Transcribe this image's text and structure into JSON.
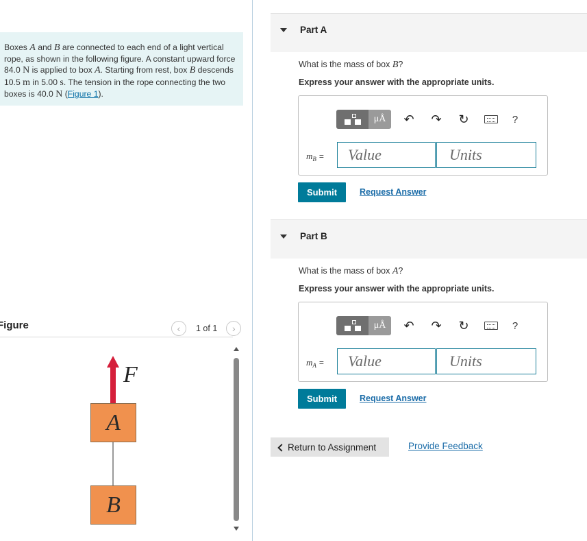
{
  "problem": {
    "t1": "Boxes ",
    "boxA": "A",
    "t2": " and ",
    "boxB": "B",
    "t3": " are connected to each end of a light vertical rope, as shown in the following figure. A constant upward force 84.0 ",
    "unitN1": "N",
    "t4": " is applied to box ",
    "boxA2": "A",
    "t5": ". Starting from rest, box ",
    "boxB2": "B",
    "t6": " descends 10.5 ",
    "unitM": "m",
    "t7": " in 5.00 ",
    "unitS": "s",
    "t8": ". The tension in the rope connecting the two boxes is 40.0 ",
    "unitN2": "N",
    "t9": " (",
    "figure_link": "Figure 1",
    "t10": ")."
  },
  "figure": {
    "title": "Figure",
    "pager": "1 of 1",
    "prev_icon": "chevron-left-icon",
    "next_icon": "chevron-right-icon",
    "force_label": "F",
    "box_a_label": "A",
    "box_b_label": "B",
    "colors": {
      "box": "#f0914e",
      "arrow": "#d51f3b"
    }
  },
  "partA": {
    "title": "Part A",
    "question_pre": "What is the mass of box ",
    "question_var": "B",
    "question_post": "?",
    "express": "Express your answer with the appropriate units.",
    "var_main": "m",
    "var_sub": "B",
    "eq": "=",
    "value_placeholder": "Value",
    "units_placeholder": "Units",
    "submit": "Submit",
    "request": "Request Answer"
  },
  "partB": {
    "title": "Part B",
    "question_pre": "What is the mass of box ",
    "question_var": "A",
    "question_post": "?",
    "express": "Express your answer with the appropriate units.",
    "var_main": "m",
    "var_sub": "A",
    "eq": "=",
    "value_placeholder": "Value",
    "units_placeholder": "Units",
    "submit": "Submit",
    "request": "Request Answer"
  },
  "toolbar": {
    "mu_label": "μÅ",
    "help": "?",
    "icons": [
      "templates-icon",
      "units-icon",
      "undo-icon",
      "redo-icon",
      "reset-icon",
      "keyboard-icon",
      "help-icon"
    ]
  },
  "footer": {
    "return": "Return to Assignment",
    "feedback": "Provide Feedback"
  },
  "colors": {
    "accent": "#007b9a",
    "link": "#1b6ca8",
    "problem_bg": "#e6f4f5"
  }
}
